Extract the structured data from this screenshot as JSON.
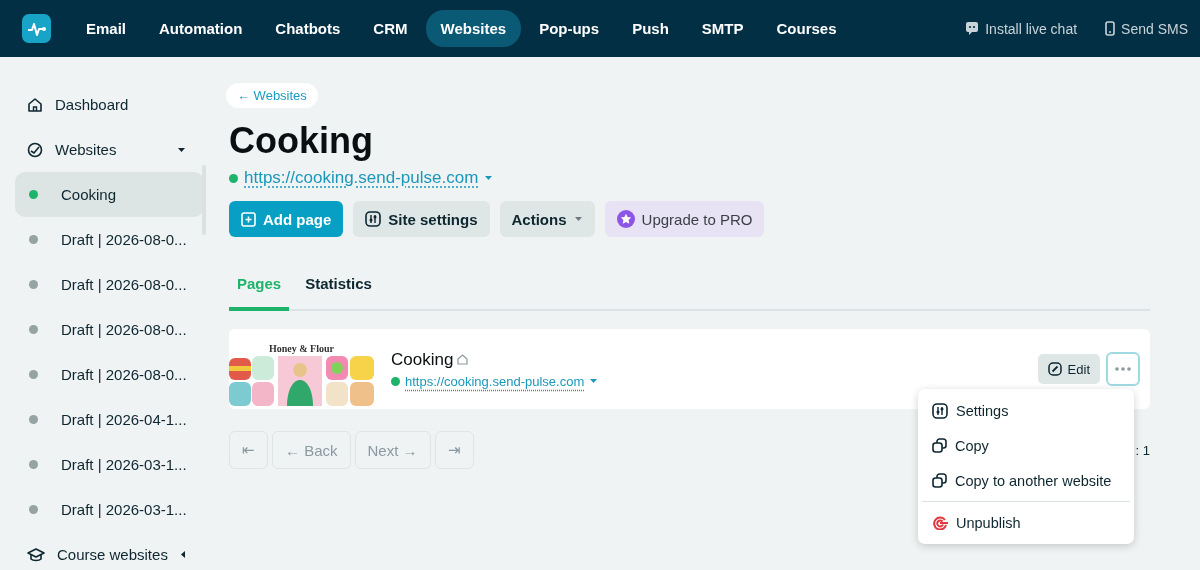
{
  "topbar": {
    "nav": [
      {
        "label": "Email",
        "selected": false
      },
      {
        "label": "Automation",
        "selected": false
      },
      {
        "label": "Chatbots",
        "selected": false
      },
      {
        "label": "CRM",
        "selected": false
      },
      {
        "label": "Websites",
        "selected": true
      },
      {
        "label": "Pop-ups",
        "selected": false
      },
      {
        "label": "Push",
        "selected": false
      },
      {
        "label": "SMTP",
        "selected": false
      },
      {
        "label": "Courses",
        "selected": false
      }
    ],
    "actions": [
      {
        "label": "Install live chat",
        "kind": "chat"
      },
      {
        "label": "Send SMS",
        "kind": "phone"
      }
    ]
  },
  "sidebar": {
    "items": [
      {
        "label": "Dashboard",
        "kind": "home"
      },
      {
        "label": "Websites",
        "kind": "sites",
        "expanded": true,
        "children": [
          {
            "label": "Cooking",
            "selected": true,
            "color": "#1db36b"
          },
          {
            "label": "Draft | 2026-08-0...",
            "selected": false,
            "color": "#95a3a3"
          },
          {
            "label": "Draft | 2026-08-0...",
            "selected": false,
            "color": "#95a3a3"
          },
          {
            "label": "Draft | 2026-08-0...",
            "selected": false,
            "color": "#95a3a3"
          },
          {
            "label": "Draft | 2026-08-0...",
            "selected": false,
            "color": "#95a3a3"
          },
          {
            "label": "Draft | 2026-04-1...",
            "selected": false,
            "color": "#95a3a3"
          },
          {
            "label": "Draft | 2026-03-1...",
            "selected": false,
            "color": "#95a3a3"
          },
          {
            "label": "Draft | 2026-03-1...",
            "selected": false,
            "color": "#95a3a3"
          }
        ]
      },
      {
        "label": "Course websites",
        "kind": "course",
        "expanded": false
      }
    ]
  },
  "breadcrumb": "← Websites",
  "title": "Cooking",
  "site_url": {
    "text": "https://cooking.send-pulse.com",
    "published": true
  },
  "toolbar": [
    {
      "label": "Add page",
      "kind": "primary"
    },
    {
      "label": "Site settings",
      "kind": "settings"
    },
    {
      "label": "Actions",
      "kind": "dropdown"
    },
    {
      "label": "Upgrade to PRO",
      "kind": "upgrade"
    }
  ],
  "tabs": [
    {
      "label": "Pages",
      "selected": true
    },
    {
      "label": "Statistics",
      "selected": false
    }
  ],
  "pages": [
    {
      "name": "Cooking",
      "home": true,
      "url": "https://cooking.send-pulse.com",
      "published": true,
      "thumbnail_title": "Honey & Flour",
      "edit_label": "Edit",
      "menu_open": true
    }
  ],
  "page_menu": [
    {
      "label": "Settings",
      "kind": "settings"
    },
    {
      "label": "Copy",
      "kind": "copy"
    },
    {
      "label": "Copy to another website",
      "kind": "copy"
    },
    {
      "label": "Unpublish",
      "kind": "unpublish"
    }
  ],
  "pager": {
    "buttons": [
      {
        "label": "⇤",
        "disabled": true
      },
      {
        "label": "← Back",
        "disabled": true
      },
      {
        "label": "Next →",
        "disabled": true
      },
      {
        "label": "⇥",
        "disabled": true
      }
    ],
    "info": ": 1"
  }
}
